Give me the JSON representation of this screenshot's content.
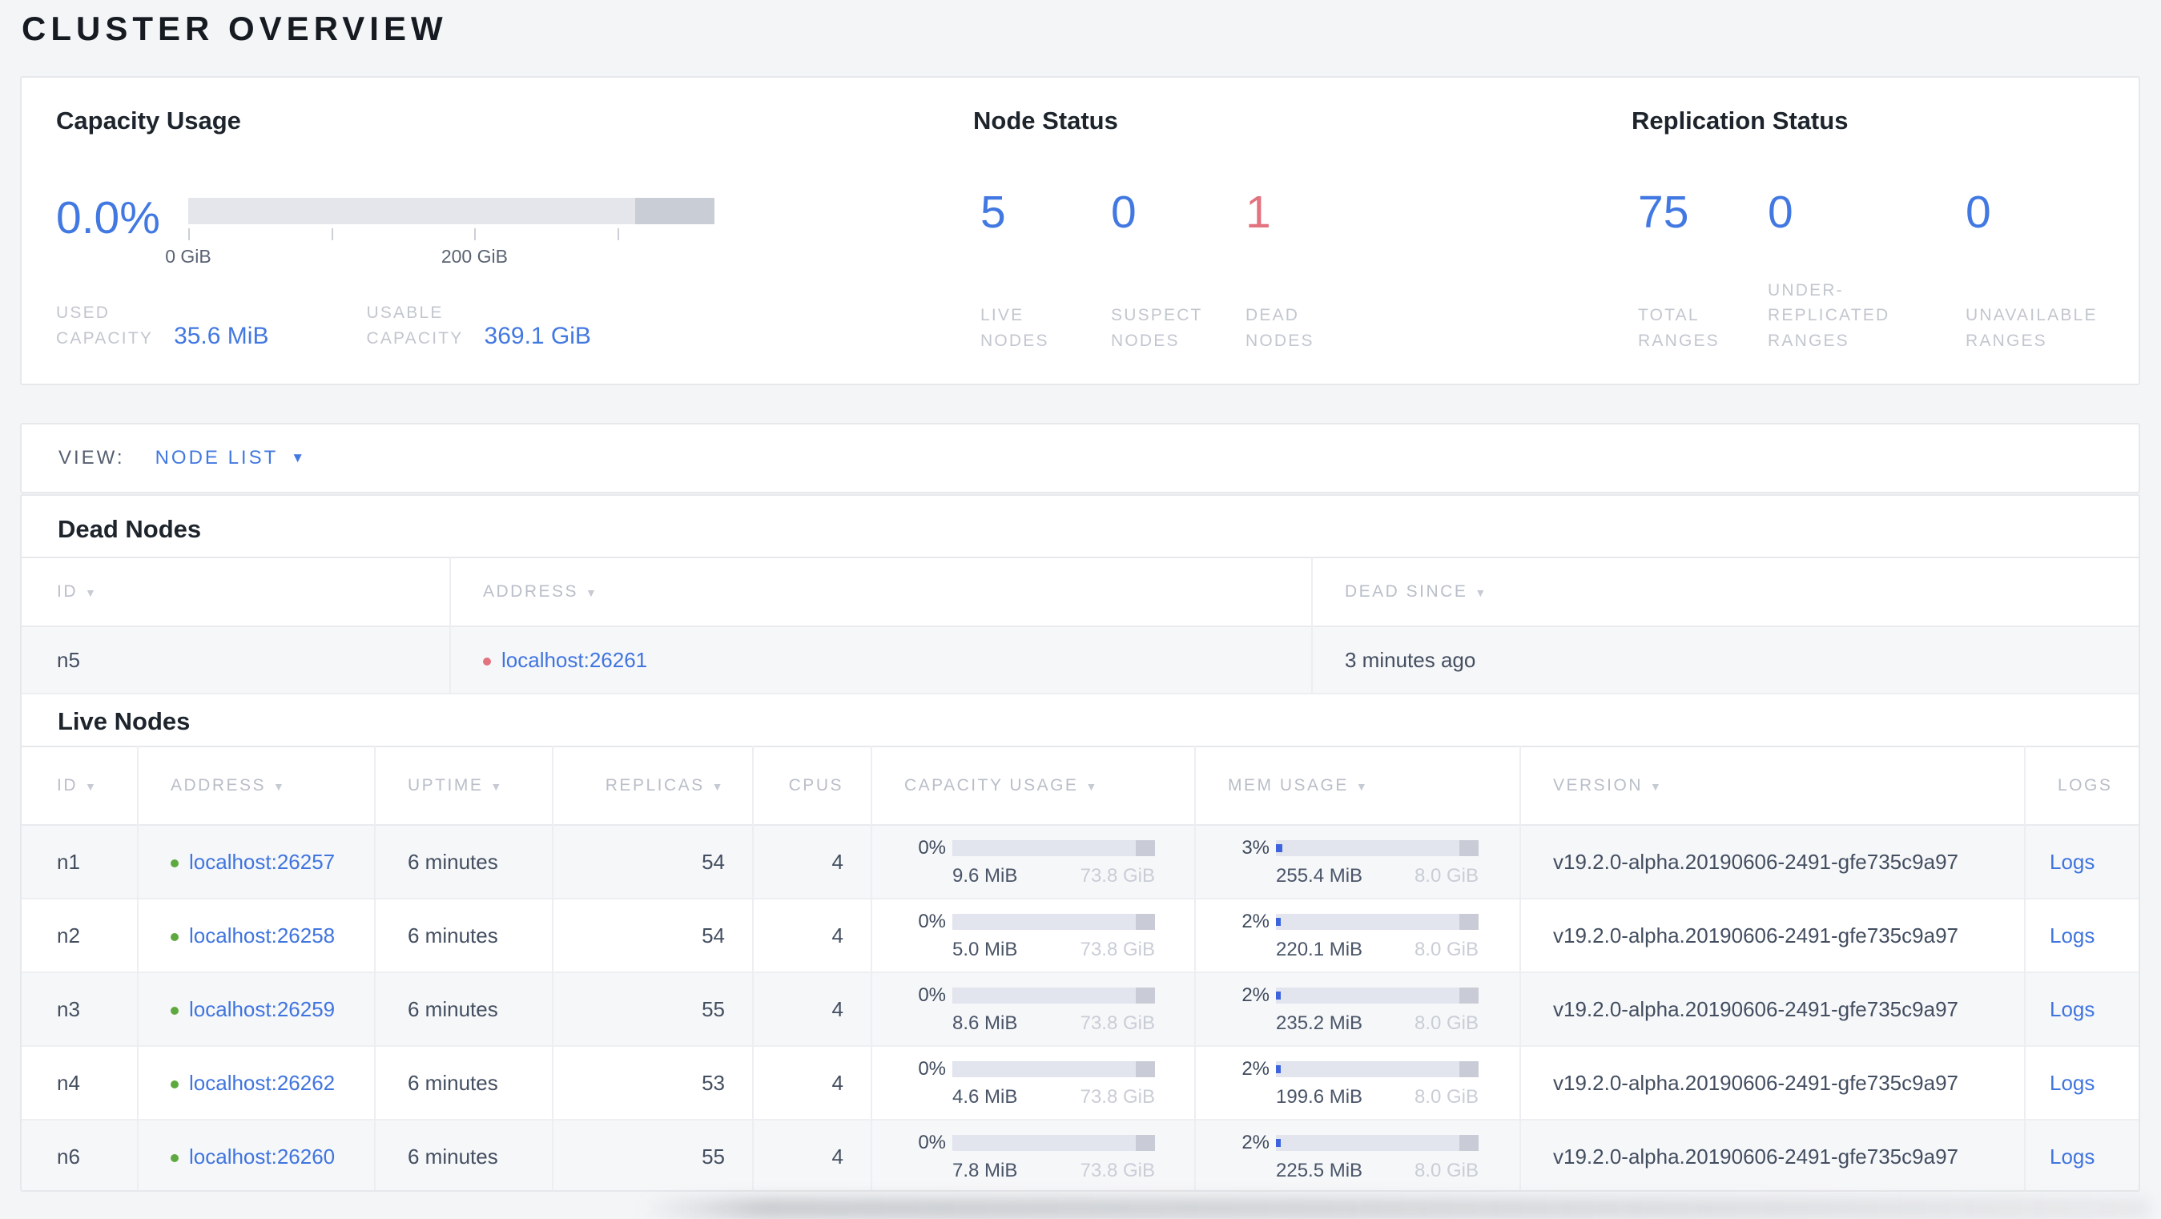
{
  "colors": {
    "accent_blue": "#4278e1",
    "dead_red": "#e2737f",
    "live_green": "#5ea93f",
    "link": "#4075df"
  },
  "icons": {
    "sort_desc": "▼",
    "dropdown_caret": "▼"
  },
  "page": {
    "title": "CLUSTER OVERVIEW"
  },
  "summary": {
    "capacity": {
      "title": "Capacity Usage",
      "percent": "0.0%",
      "bar": {
        "dark_pct": 15
      },
      "ticks": [
        {
          "pos": 0,
          "label": "0 GiB"
        },
        {
          "pos": 27.2,
          "label": ""
        },
        {
          "pos": 54.4,
          "label": "200 GiB"
        },
        {
          "pos": 81.6,
          "label": ""
        }
      ],
      "stats": [
        {
          "label": "USED\nCAPACITY",
          "value": "35.6 MiB"
        },
        {
          "label": "USABLE\nCAPACITY",
          "value": "369.1 GiB"
        }
      ]
    },
    "node_status": {
      "title": "Node Status",
      "metrics": [
        {
          "value": "5",
          "label": "LIVE\nNODES"
        },
        {
          "value": "0",
          "label": "SUSPECT\nNODES"
        },
        {
          "value": "1",
          "label": "DEAD\nNODES",
          "color": "#e2737f"
        }
      ]
    },
    "replication": {
      "title": "Replication Status",
      "metrics": [
        {
          "value": "75",
          "label": "TOTAL\nRANGES"
        },
        {
          "value": "0",
          "label": "UNDER-\nREPLICATED\nRANGES"
        },
        {
          "value": "0",
          "label": "UNAVAILABLE\nRANGES"
        }
      ]
    }
  },
  "view_bar": {
    "label": "VIEW:",
    "value": "NODE LIST"
  },
  "dead_nodes": {
    "title": "Dead Nodes",
    "columns": [
      {
        "label": "ID",
        "sortable": true
      },
      {
        "label": "ADDRESS",
        "sortable": true
      },
      {
        "label": "DEAD SINCE",
        "sortable": true
      }
    ],
    "rows": [
      {
        "id": "n5",
        "address": "localhost:26261",
        "status": "dead",
        "dead_since": "3 minutes ago"
      }
    ]
  },
  "live_nodes": {
    "title": "Live Nodes",
    "columns": [
      {
        "label": "ID",
        "sortable": true,
        "align": "left"
      },
      {
        "label": "ADDRESS",
        "sortable": true,
        "align": "left"
      },
      {
        "label": "UPTIME",
        "sortable": true,
        "align": "left"
      },
      {
        "label": "REPLICAS",
        "sortable": true,
        "align": "right"
      },
      {
        "label": "CPUS",
        "sortable": false,
        "align": "right"
      },
      {
        "label": "CAPACITY USAGE",
        "sortable": true,
        "align": "left"
      },
      {
        "label": "MEM USAGE",
        "sortable": true,
        "align": "left"
      },
      {
        "label": "VERSION",
        "sortable": true,
        "align": "left"
      },
      {
        "label": "LOGS",
        "sortable": false,
        "align": "left"
      }
    ],
    "rows": [
      {
        "id": "n1",
        "address": "localhost:26257",
        "status": "live",
        "uptime": "6 minutes",
        "replicas": "54",
        "cpus": "4",
        "capacity": {
          "percent": "0%",
          "pct": 0,
          "used": "9.6 MiB",
          "total": "73.8 GiB"
        },
        "memory": {
          "percent": "3%",
          "pct": 3,
          "used": "255.4 MiB",
          "total": "8.0 GiB"
        },
        "version": "v19.2.0-alpha.20190606-2491-gfe735c9a97",
        "logs": "Logs"
      },
      {
        "id": "n2",
        "address": "localhost:26258",
        "status": "live",
        "uptime": "6 minutes",
        "replicas": "54",
        "cpus": "4",
        "capacity": {
          "percent": "0%",
          "pct": 0,
          "used": "5.0 MiB",
          "total": "73.8 GiB"
        },
        "memory": {
          "percent": "2%",
          "pct": 2.5,
          "used": "220.1 MiB",
          "total": "8.0 GiB"
        },
        "version": "v19.2.0-alpha.20190606-2491-gfe735c9a97",
        "logs": "Logs"
      },
      {
        "id": "n3",
        "address": "localhost:26259",
        "status": "live",
        "uptime": "6 minutes",
        "replicas": "55",
        "cpus": "4",
        "capacity": {
          "percent": "0%",
          "pct": 0,
          "used": "8.6 MiB",
          "total": "73.8 GiB"
        },
        "memory": {
          "percent": "2%",
          "pct": 2.5,
          "used": "235.2 MiB",
          "total": "8.0 GiB"
        },
        "version": "v19.2.0-alpha.20190606-2491-gfe735c9a97",
        "logs": "Logs"
      },
      {
        "id": "n4",
        "address": "localhost:26262",
        "status": "live",
        "uptime": "6 minutes",
        "replicas": "53",
        "cpus": "4",
        "capacity": {
          "percent": "0%",
          "pct": 0,
          "used": "4.6 MiB",
          "total": "73.8 GiB"
        },
        "memory": {
          "percent": "2%",
          "pct": 2.5,
          "used": "199.6 MiB",
          "total": "8.0 GiB"
        },
        "version": "v19.2.0-alpha.20190606-2491-gfe735c9a97",
        "logs": "Logs"
      },
      {
        "id": "n6",
        "address": "localhost:26260",
        "status": "live",
        "uptime": "6 minutes",
        "replicas": "55",
        "cpus": "4",
        "capacity": {
          "percent": "0%",
          "pct": 0,
          "used": "7.8 MiB",
          "total": "73.8 GiB"
        },
        "memory": {
          "percent": "2%",
          "pct": 2.5,
          "used": "225.5 MiB",
          "total": "8.0 GiB"
        },
        "version": "v19.2.0-alpha.20190606-2491-gfe735c9a97",
        "logs": "Logs"
      }
    ]
  }
}
